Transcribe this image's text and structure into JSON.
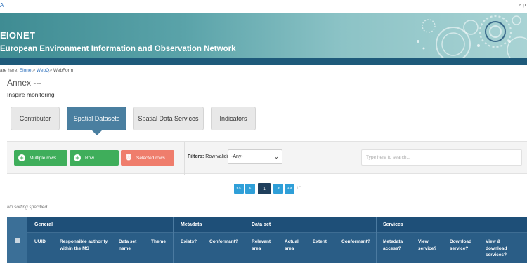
{
  "topbar": {
    "left_fragment": "A",
    "right_fragment": "a p"
  },
  "header": {
    "brand": "EIONET",
    "subtitle": "European Environment Information and Observation Network"
  },
  "breadcrumb": {
    "prefix": "are here:",
    "items": [
      "Eionet",
      "WebQ",
      "WebForm"
    ],
    "separator": ">"
  },
  "page": {
    "title": "Annex ---",
    "subtitle": "Inspire monitoring"
  },
  "tabs": [
    {
      "label": "Contributor",
      "active": false
    },
    {
      "label": "Spatial Datasets",
      "active": true
    },
    {
      "label": "Spatial Data Services",
      "active": false
    },
    {
      "label": "Indicators",
      "active": false
    }
  ],
  "toolbar": {
    "multiple_rows_label": "Multiple rows",
    "row_label": "Row",
    "selected_rows_label": "Selected rows",
    "filters_label": "Filters:",
    "row_validity_label": "Row validity",
    "row_validity_value": "-Any-",
    "search_placeholder": "Type here to search..."
  },
  "pagination": {
    "first": "<<",
    "prev": "<",
    "current": "1",
    "next": ">",
    "last": ">>",
    "info": "1/1"
  },
  "sorting_note": "No sorting specified",
  "table": {
    "groups": [
      "General",
      "Metadata",
      "Data set",
      "Services"
    ],
    "columns": [
      "UUID",
      "Responsible authority within the MS",
      "Data set name",
      "Theme",
      "Exists?",
      "Conformant?",
      "Relevant area",
      "Actual area",
      "Extent",
      "Conformant?",
      "Metadata access?",
      "View service?",
      "Download service?",
      "View & download services?"
    ]
  },
  "colors": {
    "banner_teal": "#5aa3a9",
    "tab_active": "#4a7fa0",
    "button_green": "#3fae5b",
    "button_red": "#ef7d6c",
    "pagination_blue": "#2f9fd8",
    "table_header": "#2a5d86"
  }
}
